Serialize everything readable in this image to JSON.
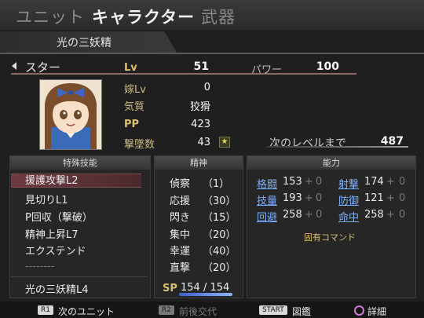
{
  "tabs": [
    "ユニット",
    "キャラクター",
    "武器"
  ],
  "subtitle": "光の三妖精",
  "name": "スター",
  "stats": {
    "lv_label": "Lv",
    "lv": "51",
    "yome_label": "嫁Lv",
    "yome": "0",
    "kishitsu_label": "気質",
    "kishitsu": "狡猾",
    "pp_label": "PP",
    "pp": "423",
    "kills_label": "撃墜数",
    "kills": "43",
    "power_label": "パワー",
    "power": "100",
    "next_label": "次のレベルまで",
    "next": "487"
  },
  "skills": {
    "header": "特殊技能",
    "items": [
      "援護攻撃L2",
      "見切りL1",
      "P回収（撃破）",
      "精神上昇L7",
      "エクステンド",
      "--------"
    ],
    "footer": "光の三妖精L4"
  },
  "spirit": {
    "header": "精神",
    "items": [
      {
        "name": "偵察",
        "cost": "（1）"
      },
      {
        "name": "応援",
        "cost": "（30）"
      },
      {
        "name": "閃き",
        "cost": "（15）"
      },
      {
        "name": "集中",
        "cost": "（20）"
      },
      {
        "name": "幸運",
        "cost": "（40）"
      },
      {
        "name": "直撃",
        "cost": "（20）"
      }
    ],
    "sp_label": "SP",
    "sp": "154 / 154",
    "sp_fill": 1.0
  },
  "ability": {
    "header": "能力",
    "rows": [
      [
        {
          "name": "格闘",
          "val": "153",
          "bonus": "+",
          "b2": "0"
        },
        {
          "name": "射撃",
          "val": "174",
          "bonus": "+",
          "b2": "0"
        }
      ],
      [
        {
          "name": "技量",
          "val": "193",
          "bonus": "+",
          "b2": "0"
        },
        {
          "name": "防御",
          "val": "121",
          "bonus": "+",
          "b2": "0"
        }
      ],
      [
        {
          "name": "回避",
          "val": "258",
          "bonus": "+",
          "b2": "0"
        },
        {
          "name": "命中",
          "val": "258",
          "bonus": "+",
          "b2": "0"
        }
      ]
    ],
    "fixed_cmd": "固有コマンド"
  },
  "footer": {
    "r1": "R1",
    "r1_label": "次のユニット",
    "r2": "R2",
    "r2_label": "前後交代",
    "start": "START",
    "start_label": "図鑑",
    "circle_label": "詳細"
  },
  "colors": {
    "accent": "#7ab0ff",
    "highlight": "#6d3b40",
    "gold": "#d8c070"
  }
}
